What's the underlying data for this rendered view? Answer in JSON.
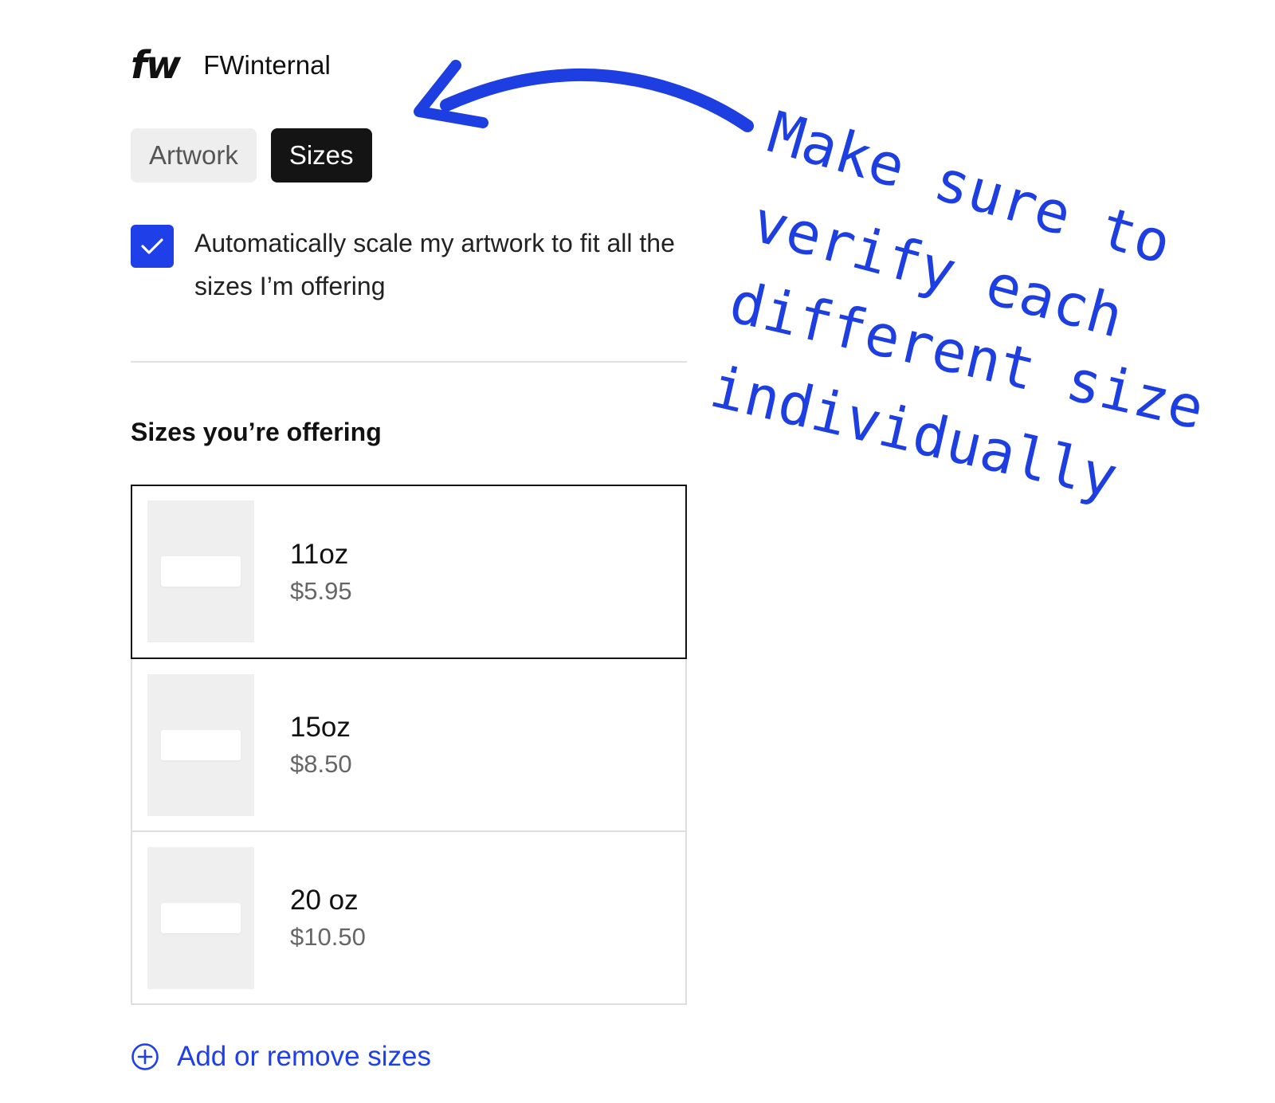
{
  "header": {
    "logo": "fw",
    "shop_name": "FWinternal"
  },
  "tabs": [
    {
      "label": "Artwork",
      "active": false
    },
    {
      "label": "Sizes",
      "active": true
    }
  ],
  "autoscale": {
    "checked": true,
    "label": "Automatically scale my artwork to fit all the sizes I’m offering"
  },
  "sizes_section": {
    "title": "Sizes you’re offering",
    "items": [
      {
        "name": "11oz",
        "price": "$5.95",
        "selected": true
      },
      {
        "name": "15oz",
        "price": "$8.50",
        "selected": false
      },
      {
        "name": "20 oz",
        "price": "$10.50",
        "selected": false
      }
    ]
  },
  "add_remove": {
    "label": "Add or remove sizes",
    "icon": "plus-circle-icon"
  },
  "annotation": {
    "lines": [
      "Make sure to",
      "verify each",
      "different size",
      "individually"
    ],
    "color": "#1d3ee0"
  },
  "colors": {
    "accent": "#1f3fe8",
    "active_tab": "#141414",
    "inactive_tab": "#eeeeee"
  }
}
